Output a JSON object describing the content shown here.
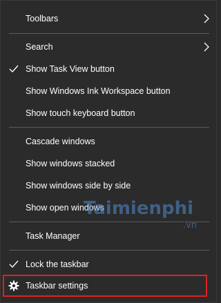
{
  "menu": {
    "items": [
      {
        "label": "Toolbars"
      },
      {
        "label": "Search"
      },
      {
        "label": "Show Task View button"
      },
      {
        "label": "Show Windows Ink Workspace button"
      },
      {
        "label": "Show touch keyboard button"
      },
      {
        "label": "Cascade windows"
      },
      {
        "label": "Show windows stacked"
      },
      {
        "label": "Show windows side by side"
      },
      {
        "label": "Show open windows"
      },
      {
        "label": "Task Manager"
      },
      {
        "label": "Lock the taskbar"
      },
      {
        "label": "Taskbar settings"
      }
    ]
  },
  "watermark": {
    "text": "Taimienphi",
    "sub": ".vn"
  },
  "colors": {
    "background": "#2b2b2b",
    "text": "#ffffff",
    "separator": "#5b5b5b",
    "highlight_border": "#e02020"
  }
}
